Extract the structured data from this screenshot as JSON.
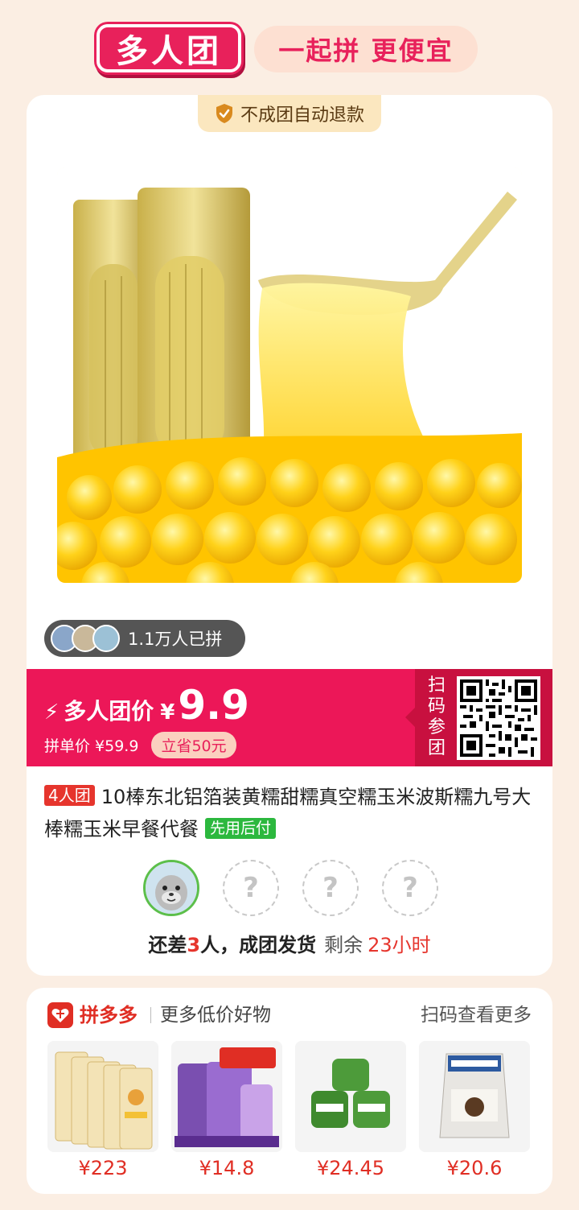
{
  "header": {
    "logo_text": "多人团",
    "slogan": "一起拼 更便宜"
  },
  "main_card": {
    "refund_badge": "不成团自动退款",
    "joined_count": "1.1万人已拼",
    "price": {
      "label": "多人团价",
      "currency": "¥",
      "value": "9.9",
      "single_price": "拼单价 ¥59.9",
      "save": "立省50元"
    },
    "scan_label": "扫码参团",
    "title": {
      "tag": "4人团",
      "text": "10棒东北铝箔装黄糯甜糯真空糯玉米波斯糯九号大棒糯玉米早餐代餐",
      "pay_tag": "先用后付"
    },
    "slots": {
      "empty_mark": "?"
    },
    "status": {
      "prefix": "还差",
      "count": "3",
      "suffix": "人，成团发货",
      "remaining_label": "剩余",
      "remaining_time": "23小时"
    }
  },
  "bottom_card": {
    "brand": "拼多多",
    "subtitle": "更多低价好物",
    "scan_more": "扫码查看更多",
    "goods": [
      {
        "price": "¥223"
      },
      {
        "price": "¥14.8"
      },
      {
        "price": "¥24.45"
      },
      {
        "price": "¥20.6"
      }
    ]
  },
  "colors": {
    "primary": "#ec1758",
    "pdd_red": "#e02e24",
    "background": "#fbeee3"
  }
}
